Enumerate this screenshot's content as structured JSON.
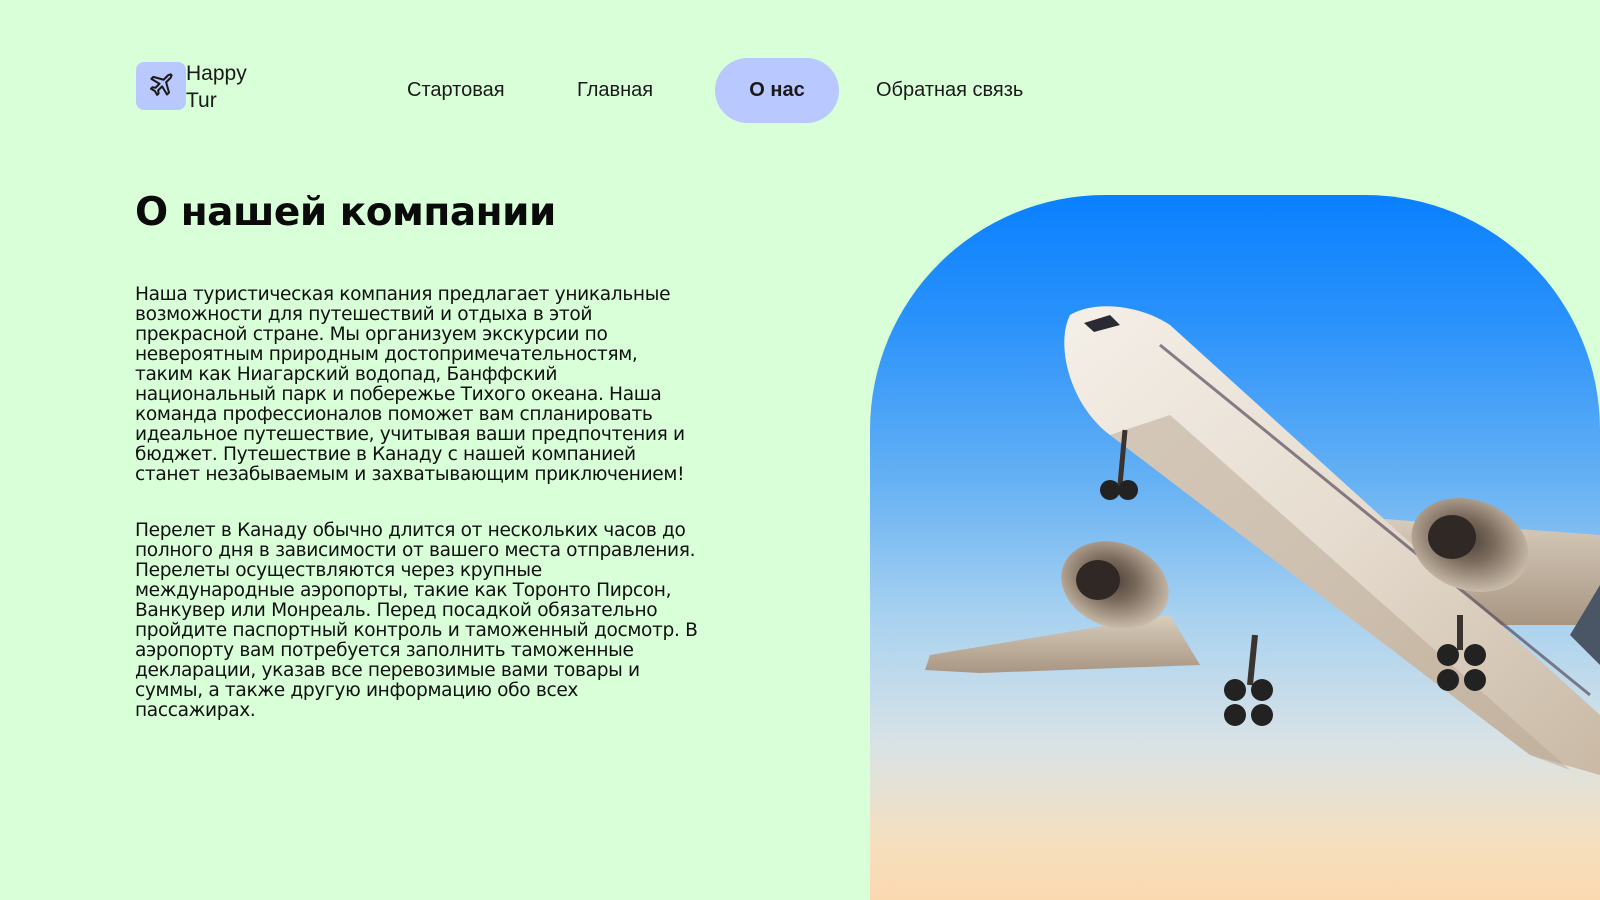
{
  "brand": {
    "line1": "Happy",
    "line2": "Tur",
    "icon": "airplane-icon",
    "tile_color": "#b9c8ff"
  },
  "nav": {
    "items": [
      {
        "label": "Стартовая",
        "active": false
      },
      {
        "label": "Главная",
        "active": false
      },
      {
        "label": "О нас",
        "active": true
      },
      {
        "label": "Обратная связь",
        "active": false
      }
    ],
    "active_color": "#b9c8ff"
  },
  "page": {
    "background": "#d9ffd9",
    "title": "О нашей компании",
    "paragraphs": [
      "Наша туристическая компания  предлагает уникальные возможности для путешествий и отдыха в этой прекрасной стране. Мы организуем экскурсии по невероятным природным достопримечательностям, таким как Ниагарский водопад, Банффский национальный парк и побережье Тихого океана. Наша команда профессионалов поможет вам спланировать идеальное путешествие, учитывая ваши предпочтения и бюджет. Путешествие в Канаду с нашей компанией станет незабываемым и захватывающим приключением!",
      "Перелет в Канаду обычно длится от нескольких часов до полного дня в зависимости от вашего места отправления. Перелеты осуществляются через крупные международные аэропорты, такие как Торонто Пирсон, Ванкувер или Монреаль. Перед посадкой обязательно пройдите паспортный контроль и таможенный досмотр. В аэропорту вам потребуется заполнить таможенные декларации, указав все перевозимые вами товары и суммы, а также другую информацию обо всех пассажирах."
    ]
  },
  "hero": {
    "image": "airplane-photo",
    "sky_top": "#0a80ff",
    "sky_bottom": "#fad9b0"
  }
}
